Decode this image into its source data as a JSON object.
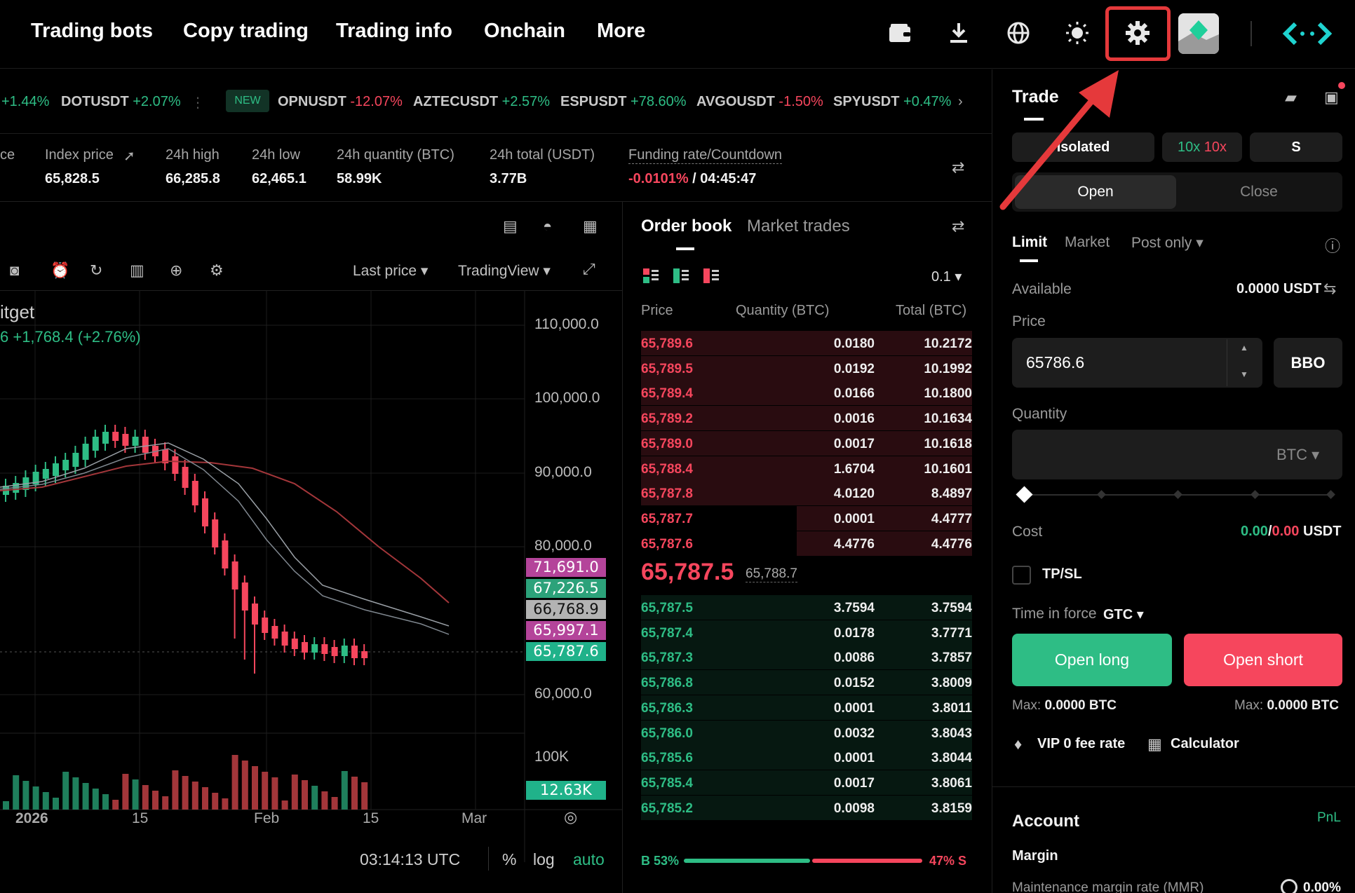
{
  "nav": {
    "items": [
      "Trading bots",
      "Copy trading",
      "Trading info",
      "Onchain",
      "More"
    ],
    "icons": [
      "wallet-icon",
      "download-icon",
      "globe-icon",
      "sun-icon",
      "gear-icon",
      "avatar",
      "logo"
    ]
  },
  "ticker": [
    {
      "symbol": "",
      "change": "+1.44%",
      "dir": "up"
    },
    {
      "symbol": "DOTUSDT",
      "change": "+2.07%",
      "dir": "up"
    },
    {
      "badge": "NEW"
    },
    {
      "symbol": "OPNUSDT",
      "change": "-12.07%",
      "dir": "dn"
    },
    {
      "symbol": "AZTECUSDT",
      "change": "+2.57%",
      "dir": "up"
    },
    {
      "symbol": "ESPUSDT",
      "change": "+78.60%",
      "dir": "up"
    },
    {
      "symbol": "AVGOUSDT",
      "change": "-1.50%",
      "dir": "dn"
    },
    {
      "symbol": "SPYUSDT",
      "change": "+0.47%",
      "dir": "up"
    }
  ],
  "stats": {
    "cut_label": "ce",
    "index_label": "Index price",
    "index_value": "65,828.5",
    "high_label": "24h high",
    "high_value": "66,285.8",
    "low_label": "24h low",
    "low_value": "62,465.1",
    "qty_label": "24h quantity (BTC)",
    "qty_value": "58.99K",
    "total_label": "24h total (USDT)",
    "total_value": "3.77B",
    "funding_label": "Funding rate/Countdown",
    "funding_rate": "-0.0101%",
    "countdown": " / 04:45:47"
  },
  "chart": {
    "price_source": "Last price",
    "chart_engine": "TradingView",
    "title_fragment": "itget",
    "change_fragment": "6  +1,768.4 (+2.76%)",
    "y_ticks": [
      "110,000.0",
      "100,000.0",
      "90,000.0",
      "80,000.0",
      "60,000.0"
    ],
    "price_tags": [
      {
        "value": "71,691.0",
        "color": "#b4449a"
      },
      {
        "value": "67,226.5",
        "color": "#2ca27a"
      },
      {
        "value": "66,768.9",
        "color": "#b3b3b3"
      },
      {
        "value": "65,997.1",
        "color": "#b4449a"
      },
      {
        "value": "65,787.6",
        "color": "#20b28a"
      }
    ],
    "vol_tick": "100K",
    "vol_tag": "12.63K",
    "x_ticks": [
      "2026",
      "15",
      "Feb",
      "15",
      "Mar"
    ],
    "clock": "03:14:13 UTC",
    "pct": "%",
    "log": "log",
    "auto": "auto"
  },
  "orderbook": {
    "tab_active": "Order book",
    "tab_other": "Market trades",
    "precision": "0.1",
    "col_price": "Price",
    "col_qty": "Quantity (BTC)",
    "col_total": "Total (BTC)",
    "asks": [
      {
        "price": "65,789.6",
        "qty": "0.0180",
        "total": "10.2172",
        "depth": 1.0
      },
      {
        "price": "65,789.5",
        "qty": "0.0192",
        "total": "10.1992",
        "depth": 1.0
      },
      {
        "price": "65,789.4",
        "qty": "0.0166",
        "total": "10.1800",
        "depth": 1.0
      },
      {
        "price": "65,789.2",
        "qty": "0.0016",
        "total": "10.1634",
        "depth": 1.0
      },
      {
        "price": "65,789.0",
        "qty": "0.0017",
        "total": "10.1618",
        "depth": 1.0
      },
      {
        "price": "65,788.4",
        "qty": "1.6704",
        "total": "10.1601",
        "depth": 1.0
      },
      {
        "price": "65,787.8",
        "qty": "4.0120",
        "total": "8.4897",
        "depth": 1.0
      },
      {
        "price": "65,787.7",
        "qty": "0.0001",
        "total": "4.4777",
        "depth": 0.53
      },
      {
        "price": "65,787.6",
        "qty": "4.4776",
        "total": "4.4776",
        "depth": 0.53
      }
    ],
    "last_price": "65,787.5",
    "mark_price": "65,788.7",
    "bids": [
      {
        "price": "65,787.5",
        "qty": "3.7594",
        "total": "3.7594",
        "depth": 1.0
      },
      {
        "price": "65,787.4",
        "qty": "0.0178",
        "total": "3.7771",
        "depth": 1.0
      },
      {
        "price": "65,787.3",
        "qty": "0.0086",
        "total": "3.7857",
        "depth": 1.0
      },
      {
        "price": "65,786.8",
        "qty": "0.0152",
        "total": "3.8009",
        "depth": 1.0
      },
      {
        "price": "65,786.3",
        "qty": "0.0001",
        "total": "3.8011",
        "depth": 1.0
      },
      {
        "price": "65,786.0",
        "qty": "0.0032",
        "total": "3.8043",
        "depth": 1.0
      },
      {
        "price": "65,785.6",
        "qty": "0.0001",
        "total": "3.8044",
        "depth": 1.0
      },
      {
        "price": "65,785.4",
        "qty": "0.0017",
        "total": "3.8061",
        "depth": 1.0
      },
      {
        "price": "65,785.2",
        "qty": "0.0098",
        "total": "3.8159",
        "depth": 1.0
      }
    ],
    "buy_ratio_label": "B 53%",
    "sell_ratio_label": "47% S",
    "buy_ratio": 0.53
  },
  "trade": {
    "tab": "Trade",
    "tab_hidden": "s",
    "margin_mode": "Isolated",
    "lev_long": "10x",
    "lev_short": "10x",
    "s_mode": "S",
    "open": "Open",
    "close": "Close",
    "order_types": [
      "Limit",
      "Market",
      "Post only"
    ],
    "available_label": "Available",
    "available_value": "0.0000 USDT",
    "price_label": "Price",
    "price_value": "65786.6",
    "bbo": "BBO",
    "qty_label": "Quantity",
    "qty_unit": "BTC",
    "cost_label": "Cost",
    "cost_green": "0.00",
    "cost_sep": "/",
    "cost_red": "0.00",
    "cost_unit": " USDT",
    "tpsl": "TP/SL",
    "tif_label": "Time in force",
    "tif_value": "GTC",
    "open_long": "Open long",
    "open_short": "Open short",
    "max_long": "Max:",
    "max_long_value": "0.0000 BTC",
    "max_short": "Max:",
    "max_short_value": "0.0000 BTC",
    "vip": "VIP 0 fee rate",
    "calc": "Calculator",
    "account": "Account",
    "pnl": "PnL",
    "margin": "Margin",
    "mmr_label": "Maintenance margin rate (MMR)",
    "mmr_value": "0.00%"
  },
  "colors": {
    "accent": "#2ebd85",
    "danger": "#f6465d",
    "highlight": "#e5393b"
  }
}
